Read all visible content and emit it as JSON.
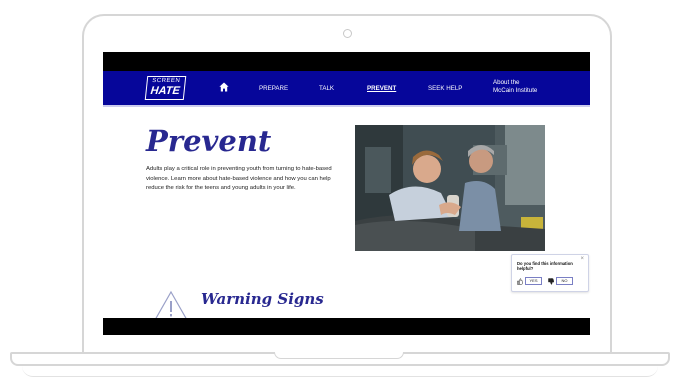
{
  "logo": {
    "line1": "SCREEN",
    "line2": "HATE"
  },
  "nav": {
    "items": [
      {
        "label": "PREPARE"
      },
      {
        "label": "TALK"
      },
      {
        "label": "PREVENT"
      },
      {
        "label": "SEEK HELP"
      }
    ],
    "about": {
      "line1": "About the",
      "line2": "McCain Institute"
    }
  },
  "hero": {
    "title": "Prevent",
    "body": "Adults play a critical role in preventing youth from turning to hate-based violence. Learn more about hate-based violence and how you can help reduce the risk for the teens and young adults in your life."
  },
  "section": {
    "title": "Warning Signs"
  },
  "feedback": {
    "close": "×",
    "question": "Do you find this information helpful?",
    "yes": "YES",
    "no": "NO"
  },
  "colors": {
    "brand": "#06069a",
    "heading": "#282890"
  },
  "icons": [
    "home-icon",
    "warning-triangle-icon",
    "thumbs-up-icon",
    "thumbs-down-icon",
    "close-icon"
  ]
}
